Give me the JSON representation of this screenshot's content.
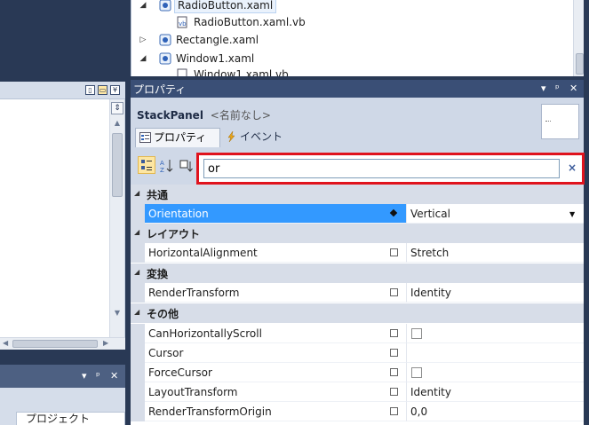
{
  "solution_tree": {
    "items": [
      {
        "label": "RadioButton.xaml",
        "expander": "◢"
      },
      {
        "label": "RadioButton.xaml.vb",
        "expander": ""
      },
      {
        "label": "Rectangle.xaml",
        "expander": "▷"
      },
      {
        "label": "Window1.xaml",
        "expander": "◢"
      },
      {
        "label": "Window1.xaml.vb",
        "expander": ""
      }
    ]
  },
  "left_panel": {
    "header_buttons": [
      "▯",
      "▭",
      "¥"
    ],
    "lower_title_controls": [
      "▾",
      "ᵖ",
      "✕"
    ],
    "lower_tab_label": "プロジェクト"
  },
  "properties": {
    "title": "プロパティ",
    "title_controls": [
      "▾",
      "ᵖ",
      "✕"
    ],
    "object_type": "StackPanel",
    "object_name": "<名前なし>",
    "tabs": [
      {
        "label": "プロパティ",
        "active": true
      },
      {
        "label": "イベント",
        "active": false
      }
    ],
    "search": {
      "value": "or",
      "clear_glyph": "×"
    },
    "categories": [
      {
        "name": "共通",
        "rows": [
          {
            "name": "Orientation",
            "value": "Vertical",
            "selected": true,
            "marker": "set",
            "dropdown": true
          }
        ]
      },
      {
        "name": "レイアウト",
        "rows": [
          {
            "name": "HorizontalAlignment",
            "value": "Stretch",
            "marker": "default"
          }
        ]
      },
      {
        "name": "変換",
        "rows": [
          {
            "name": "RenderTransform",
            "value": "Identity",
            "marker": "default"
          }
        ]
      },
      {
        "name": "その他",
        "rows": [
          {
            "name": "CanHorizontallyScroll",
            "value": "",
            "checkbox": true,
            "marker": "default"
          },
          {
            "name": "Cursor",
            "value": "",
            "marker": "default"
          },
          {
            "name": "ForceCursor",
            "value": "",
            "checkbox": true,
            "marker": "default"
          },
          {
            "name": "LayoutTransform",
            "value": "Identity",
            "marker": "default"
          },
          {
            "name": "RenderTransformOrigin",
            "value": "0,0",
            "marker": "default"
          }
        ]
      }
    ]
  },
  "colors": {
    "chrome": "#293955",
    "panel_title": "#3A4F76",
    "panel_bg": "#CFD8E7",
    "category_bg": "#D7DDE8",
    "selection": "#3399FF",
    "highlight_frame": "#E0131D"
  }
}
